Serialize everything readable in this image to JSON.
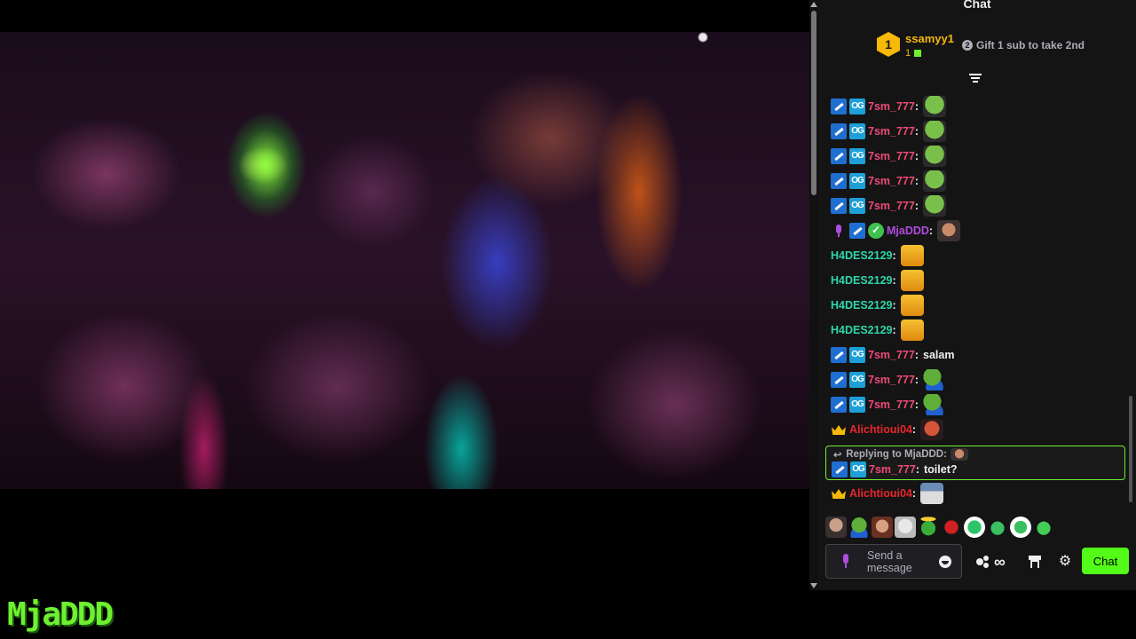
{
  "streamer": {
    "name": "MjaDDD"
  },
  "chat": {
    "title": "Chat",
    "leaderboard": {
      "rank": "1",
      "name": "ssamyy1",
      "count": "1",
      "hint_number": "2",
      "hint_text": "Gift 1 sub to take 2nd"
    },
    "messages": [
      {
        "badges": [
          "mod-icon",
          "og-badge"
        ],
        "user": "7sm_777",
        "user_color": "#f04a78",
        "text": "",
        "emote": "pepe-emote"
      },
      {
        "badges": [
          "mod-icon",
          "og-badge"
        ],
        "user": "7sm_777",
        "user_color": "#f04a78",
        "text": "",
        "emote": "pepe-emote"
      },
      {
        "badges": [
          "mod-icon",
          "og-badge"
        ],
        "user": "7sm_777",
        "user_color": "#f04a78",
        "text": "",
        "emote": "pepe-emote"
      },
      {
        "badges": [
          "mod-icon",
          "og-badge"
        ],
        "user": "7sm_777",
        "user_color": "#f04a78",
        "text": "",
        "emote": "pepe-emote"
      },
      {
        "badges": [
          "mod-icon",
          "og-badge"
        ],
        "user": "7sm_777",
        "user_color": "#f04a78",
        "text": "",
        "emote": "pepe-emote"
      },
      {
        "badges": [
          "mic-icon",
          "mod-icon",
          "verified-icon"
        ],
        "user": "MjaDDD",
        "user_color": "#b04ce0",
        "text": "",
        "emote": "face-emote"
      },
      {
        "badges": [],
        "user": "H4DES2129",
        "user_color": "#2fd6a8",
        "text": "",
        "emote": "yellow-emote"
      },
      {
        "badges": [],
        "user": "H4DES2129",
        "user_color": "#2fd6a8",
        "text": "",
        "emote": "yellow-emote"
      },
      {
        "badges": [],
        "user": "H4DES2129",
        "user_color": "#2fd6a8",
        "text": "",
        "emote": "yellow-emote"
      },
      {
        "badges": [],
        "user": "H4DES2129",
        "user_color": "#2fd6a8",
        "text": "",
        "emote": "yellow-emote"
      },
      {
        "badges": [
          "mod-icon",
          "og-badge"
        ],
        "user": "7sm_777",
        "user_color": "#f04a78",
        "text": "salam",
        "emote": ""
      },
      {
        "badges": [
          "mod-icon",
          "og-badge"
        ],
        "user": "7sm_777",
        "user_color": "#f04a78",
        "text": "",
        "emote": "pepe2-emote"
      },
      {
        "badges": [
          "mod-icon",
          "og-badge"
        ],
        "user": "7sm_777",
        "user_color": "#f04a78",
        "text": "",
        "emote": "pepe2-emote"
      },
      {
        "badges": [
          "crown-icon"
        ],
        "user": "Alichtioui04",
        "user_color": "#e8262c",
        "text": "",
        "emote": "red-emote"
      }
    ],
    "reply": {
      "label": "Replying to MjaDDD:",
      "badges": [
        "mod-icon",
        "og-badge"
      ],
      "user": "7sm_777",
      "user_color": "#f04a78",
      "text": "toilet?"
    },
    "last_message": {
      "badges": [
        "crown-icon"
      ],
      "user": "Alichtioui04",
      "user_color": "#e8262c",
      "text": "",
      "emote": "man-emote"
    },
    "og_label": "OG",
    "colon": ":",
    "input": {
      "placeholder": "Send a message"
    },
    "infinity": "∞",
    "gear": "⚙",
    "send_label": "Chat"
  }
}
